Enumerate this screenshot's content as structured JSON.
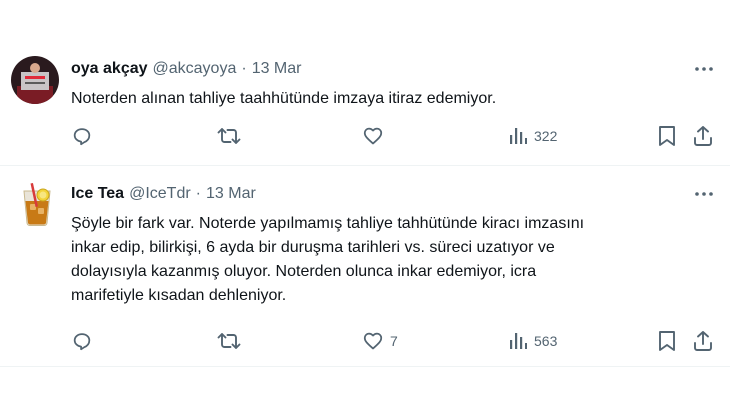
{
  "tweets": [
    {
      "name": "oya akçay",
      "handle": "@akcayoya",
      "separator": "·",
      "date": "13 Mar",
      "text": "Noterden alınan tahliye taahhütünde imzaya itiraz edemiyor.",
      "replies": "",
      "reposts": "",
      "likes": "",
      "views": "322",
      "avatar_icon": "avatar-photo-icon"
    },
    {
      "name": "Ice Tea",
      "handle": "@IceTdr",
      "separator": "·",
      "date": "13 Mar",
      "text": "Şöyle bir fark var. Noterde yapılmamış tahliye tahhütünde kiracı imzasını\ninkar edip, bilirkişi, 6 ayda bir duruşma tarihleri vs. süreci uzatıyor ve\ndolayısıyla kazanmış oluyor. Noterden olunca inkar edemiyor, icra\nmarifetiyle kısadan dehleniyor.",
      "replies": "",
      "reposts": "",
      "likes": "7",
      "views": "563",
      "avatar_icon": "iced-tea-glass-icon"
    }
  ],
  "colors": {
    "text_primary": "#0f1419",
    "text_secondary": "#536471",
    "divider": "#eff3f4"
  }
}
